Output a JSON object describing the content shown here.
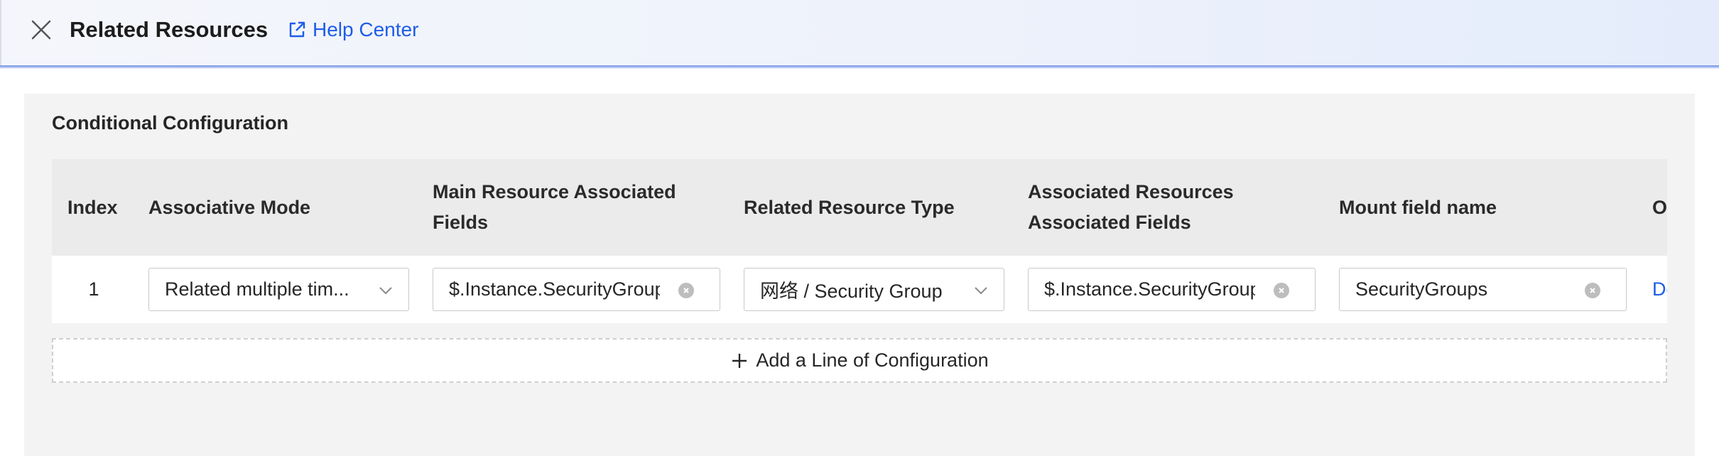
{
  "header": {
    "title": "Related Resources",
    "help_label": "Help Center",
    "close_icon": "close-icon",
    "help_icon": "external-link-icon",
    "accent_color": "#1d5de8"
  },
  "panel": {
    "title": "Conditional Configuration",
    "columns": {
      "index": "Index",
      "mode": "Associative Mode",
      "main_fields_line1": "Main Resource Associated",
      "main_fields_line2": "Fields",
      "related_type": "Related Resource Type",
      "assoc_fields_line1": "Associated Resources",
      "assoc_fields_line2": "Associated Fields",
      "mount_field": "Mount field name",
      "operation": "Operation"
    },
    "rows": [
      {
        "index": "1",
        "mode": "Related multiple tim...",
        "main_fields": "$.Instance.SecurityGroupIds",
        "related_type": "网络 / Security Group",
        "assoc_fields": "$.Instance.SecurityGroupIds",
        "mount_field": "SecurityGroups",
        "operation": "Delete"
      }
    ],
    "add_line_label": "Add a Line of Configuration"
  }
}
